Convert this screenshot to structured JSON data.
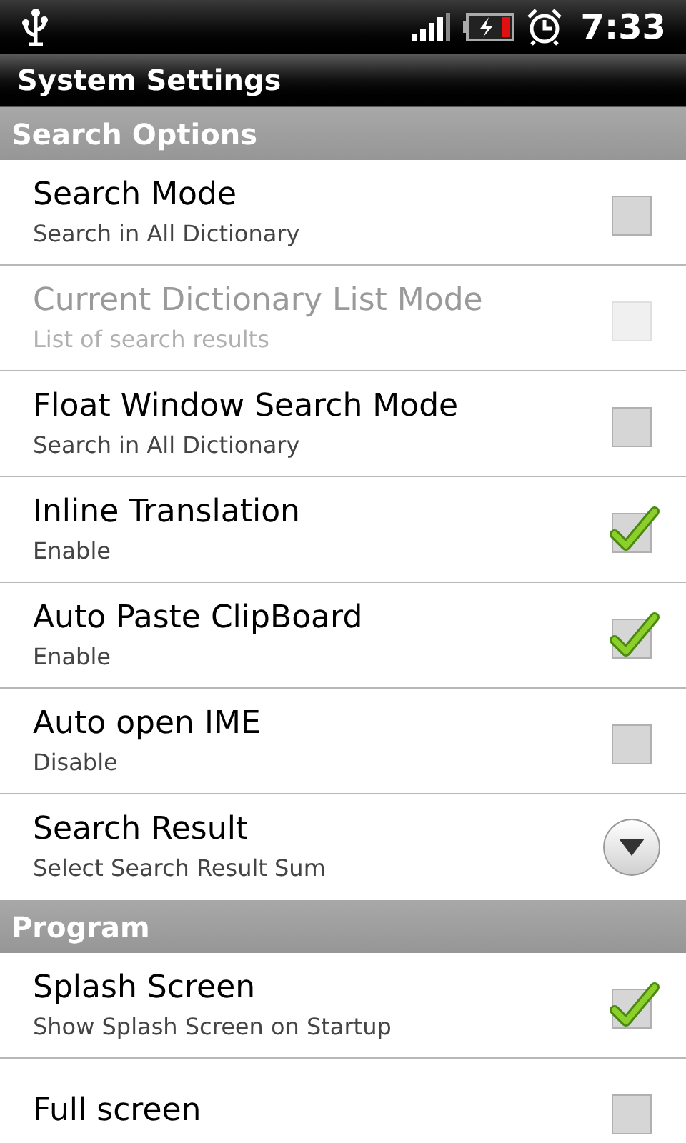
{
  "status_bar": {
    "time": "7:33"
  },
  "title": "System Settings",
  "sections": [
    {
      "header": "Search Options",
      "items": [
        {
          "kind": "checkbox",
          "title": "Search Mode",
          "summary": "Search in All Dictionary",
          "checked": false,
          "disabled": false
        },
        {
          "kind": "checkbox",
          "title": "Current Dictionary List Mode",
          "summary": "List of search results",
          "checked": false,
          "disabled": true
        },
        {
          "kind": "checkbox",
          "title": "Float Window Search Mode",
          "summary": "Search in All Dictionary",
          "checked": false,
          "disabled": false
        },
        {
          "kind": "checkbox",
          "title": "Inline Translation",
          "summary": "Enable",
          "checked": true,
          "disabled": false
        },
        {
          "kind": "checkbox",
          "title": "Auto Paste ClipBoard",
          "summary": "Enable",
          "checked": true,
          "disabled": false
        },
        {
          "kind": "checkbox",
          "title": "Auto open IME",
          "summary": "Disable",
          "checked": false,
          "disabled": false
        },
        {
          "kind": "dropdown",
          "title": "Search Result",
          "summary": "Select Search Result Sum",
          "disabled": false
        }
      ]
    },
    {
      "header": "Program",
      "items": [
        {
          "kind": "checkbox",
          "title": "Splash Screen",
          "summary": "Show Splash Screen on Startup",
          "checked": true,
          "disabled": false
        },
        {
          "kind": "checkbox",
          "title": "Full screen",
          "checked": false,
          "disabled": false
        }
      ]
    }
  ]
}
